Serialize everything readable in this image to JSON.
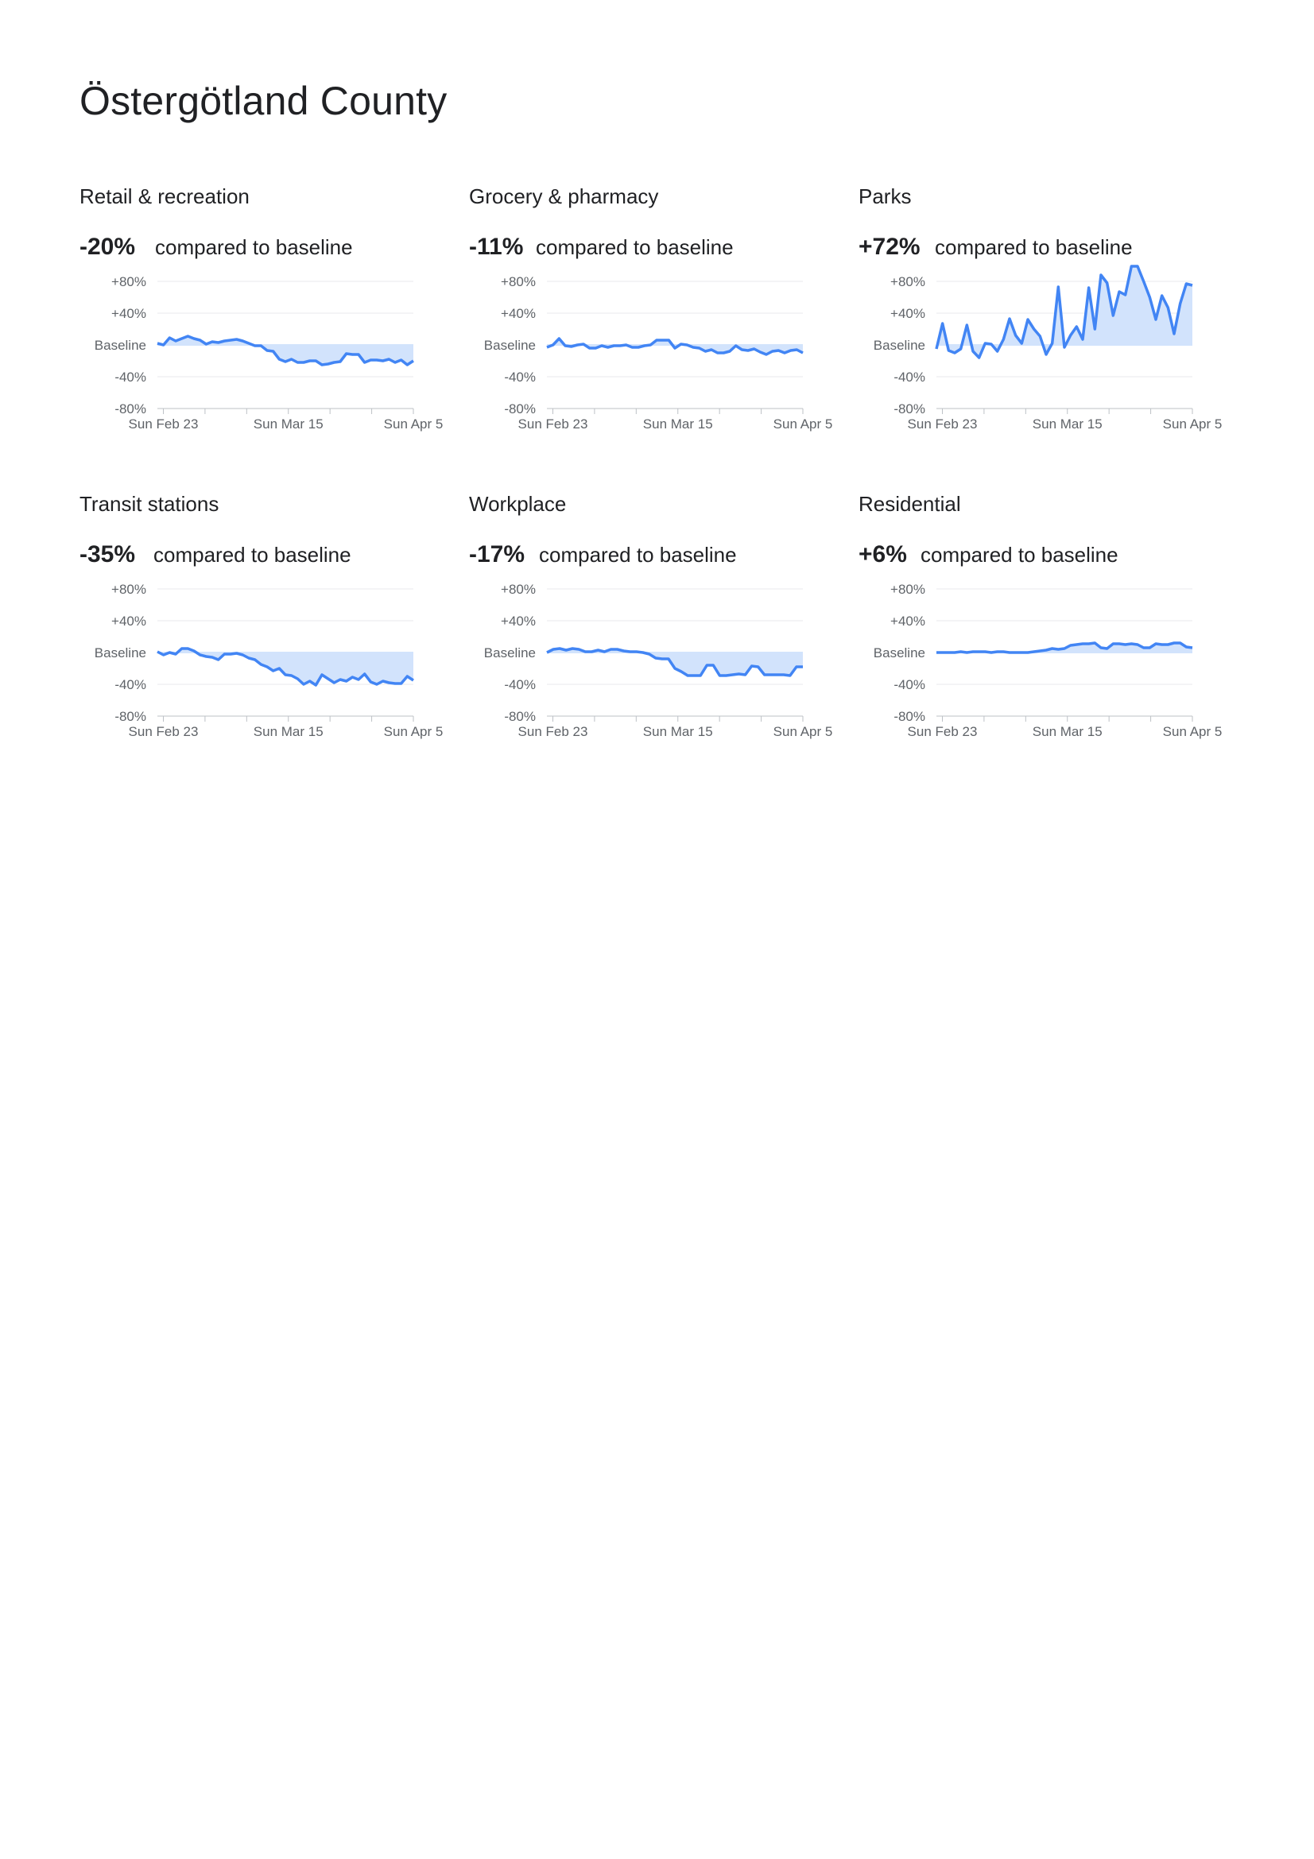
{
  "page": {
    "title": "Östergötland County"
  },
  "colors": {
    "line": "#4285f4",
    "fill": "#d2e3fc",
    "grid": "#e8eaed",
    "axis": "#bdc1c6",
    "label": "#5f6368"
  },
  "chart_data": [
    {
      "type": "area",
      "title": "Retail & recreation",
      "headline": "-20%",
      "headline_suffix": "compared to baseline",
      "ylim": [
        -80,
        80
      ],
      "yticks": [
        "+80%",
        "+40%",
        "Baseline",
        "-40%",
        "-80%"
      ],
      "xticks": [
        "Sun Feb 23",
        "Sun Mar 15",
        "Sun Apr 5"
      ],
      "x_range": [
        "2020-02-22",
        "2020-04-05"
      ],
      "values": [
        2,
        0,
        9,
        5,
        8,
        11,
        8,
        6,
        1,
        4,
        3,
        5,
        6,
        7,
        5,
        2,
        -1,
        -1,
        -7,
        -8,
        -18,
        -21,
        -18,
        -22,
        -22,
        -20,
        -20,
        -25,
        -24,
        -22,
        -21,
        -11,
        -12,
        -12,
        -22,
        -19,
        -19,
        -20,
        -18,
        -22,
        -19,
        -25,
        -20
      ]
    },
    {
      "type": "area",
      "title": "Grocery & pharmacy",
      "headline": "-11%",
      "headline_suffix": "compared to baseline",
      "ylim": [
        -80,
        80
      ],
      "yticks": [
        "+80%",
        "+40%",
        "Baseline",
        "-40%",
        "-80%"
      ],
      "xticks": [
        "Sun Feb 23",
        "Sun Mar 15",
        "Sun Apr 5"
      ],
      "x_range": [
        "2020-02-22",
        "2020-04-05"
      ],
      "values": [
        -3,
        0,
        8,
        -1,
        -2,
        0,
        1,
        -4,
        -4,
        -1,
        -3,
        -1,
        -1,
        0,
        -3,
        -3,
        -1,
        0,
        6,
        6,
        6,
        -4,
        1,
        0,
        -3,
        -4,
        -8,
        -6,
        -10,
        -10,
        -8,
        -1,
        -6,
        -7,
        -5,
        -9,
        -12,
        -8,
        -7,
        -10,
        -7,
        -6,
        -10
      ]
    },
    {
      "type": "area",
      "title": "Parks",
      "headline": "+72%",
      "headline_suffix": "compared to baseline",
      "ylim": [
        -80,
        80
      ],
      "yticks": [
        "+80%",
        "+40%",
        "Baseline",
        "-40%",
        "-80%"
      ],
      "xticks": [
        "Sun Feb 23",
        "Sun Mar 15",
        "Sun Apr 5"
      ],
      "x_range": [
        "2020-02-22",
        "2020-04-05"
      ],
      "values": [
        -5,
        27,
        -7,
        -10,
        -5,
        25,
        -8,
        -16,
        2,
        1,
        -8,
        7,
        33,
        12,
        2,
        32,
        20,
        11,
        -12,
        2,
        73,
        -3,
        12,
        23,
        7,
        72,
        20,
        88,
        78,
        37,
        67,
        63,
        99,
        99,
        80,
        60,
        32,
        62,
        47,
        14,
        52,
        77,
        75
      ]
    },
    {
      "type": "area",
      "title": "Transit stations",
      "headline": "-35%",
      "headline_suffix": "compared to baseline",
      "ylim": [
        -80,
        80
      ],
      "yticks": [
        "+80%",
        "+40%",
        "Baseline",
        "-40%",
        "-80%"
      ],
      "xticks": [
        "Sun Feb 23",
        "Sun Mar 15",
        "Sun Apr 5"
      ],
      "x_range": [
        "2020-02-22",
        "2020-04-05"
      ],
      "values": [
        1,
        -3,
        0,
        -2,
        5,
        5,
        2,
        -3,
        -5,
        -6,
        -9,
        -2,
        -2,
        -1,
        -3,
        -7,
        -9,
        -15,
        -18,
        -23,
        -20,
        -28,
        -29,
        -33,
        -40,
        -36,
        -41,
        -28,
        -33,
        -38,
        -34,
        -36,
        -31,
        -34,
        -27,
        -37,
        -40,
        -36,
        -38,
        -39,
        -39,
        -30,
        -35
      ]
    },
    {
      "type": "area",
      "title": "Workplace",
      "headline": "-17%",
      "headline_suffix": "compared to baseline",
      "ylim": [
        -80,
        80
      ],
      "yticks": [
        "+80%",
        "+40%",
        "Baseline",
        "-40%",
        "-80%"
      ],
      "xticks": [
        "Sun Feb 23",
        "Sun Mar 15",
        "Sun Apr 5"
      ],
      "x_range": [
        "2020-02-22",
        "2020-04-05"
      ],
      "values": [
        0,
        4,
        5,
        3,
        5,
        4,
        1,
        1,
        3,
        1,
        4,
        4,
        2,
        1,
        1,
        0,
        -2,
        -7,
        -8,
        -8,
        -20,
        -24,
        -29,
        -29,
        -29,
        -16,
        -16,
        -29,
        -29,
        -28,
        -27,
        -28,
        -17,
        -18,
        -28,
        -28,
        -28,
        -28,
        -29,
        -18,
        -18
      ]
    },
    {
      "type": "area",
      "title": "Residential",
      "headline": "+6%",
      "headline_suffix": "compared to baseline",
      "ylim": [
        -80,
        80
      ],
      "yticks": [
        "+80%",
        "+40%",
        "Baseline",
        "-40%",
        "-80%"
      ],
      "xticks": [
        "Sun Feb 23",
        "Sun Mar 15",
        "Sun Apr 5"
      ],
      "x_range": [
        "2020-02-22",
        "2020-04-05"
      ],
      "values": [
        0,
        0,
        0,
        0,
        1,
        0,
        1,
        1,
        1,
        0,
        1,
        1,
        0,
        0,
        0,
        0,
        1,
        2,
        3,
        5,
        4,
        5,
        9,
        10,
        11,
        11,
        12,
        6,
        5,
        11,
        11,
        10,
        11,
        10,
        6,
        6,
        11,
        10,
        10,
        12,
        12,
        7,
        6
      ]
    }
  ]
}
